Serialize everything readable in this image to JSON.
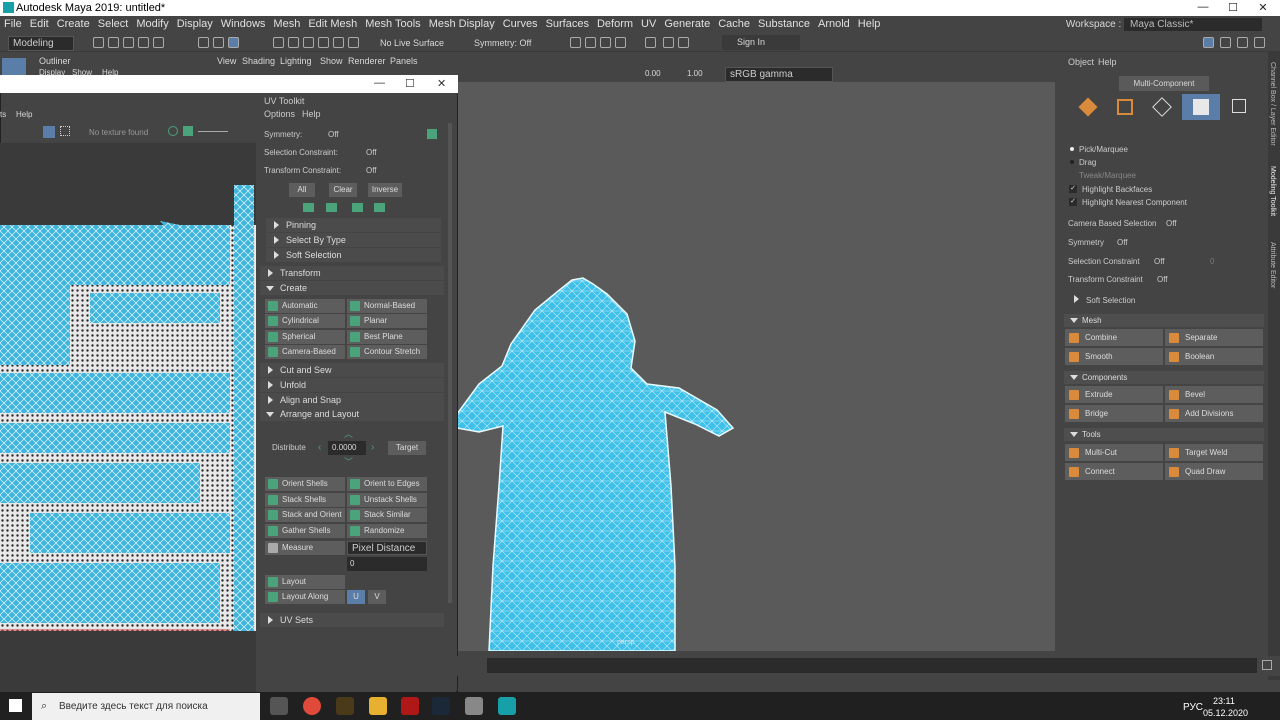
{
  "title": {
    "text": "Autodesk Maya 2019: untitled*",
    "min": "—",
    "max": "☐",
    "close": "✕"
  },
  "menu": [
    "File",
    "Edit",
    "Create",
    "Select",
    "Modify",
    "Display",
    "Windows",
    "Mesh",
    "Edit Mesh",
    "Mesh Tools",
    "Mesh Display",
    "Curves",
    "Surfaces",
    "Deform",
    "UV",
    "Generate",
    "Cache",
    "Substance",
    "Arnold",
    "Help"
  ],
  "workspace": {
    "label": "Workspace :",
    "value": "Maya Classic*"
  },
  "status": {
    "mode": "Modeling",
    "live": "No Live Surface",
    "symmetry": "Symmetry: Off",
    "signin": "Sign In"
  },
  "outliner": {
    "title": "Outliner",
    "menu": [
      "Display",
      "Show",
      "Help"
    ]
  },
  "viewport": {
    "menu": [
      "View",
      "Shading",
      "Lighting",
      "Show",
      "Renderer",
      "Panels"
    ],
    "v1": "0.00",
    "v2": "1.00",
    "gamma": "sRGB gamma",
    "label": "persp"
  },
  "uveditor": {
    "menu": [
      "ts",
      "Help"
    ],
    "notex": "No texture found",
    "min": "—",
    "max": "☐",
    "close": "✕"
  },
  "toolkit": {
    "title": "UV Toolkit",
    "menu": [
      "Options",
      "Help"
    ],
    "symmetry": "Symmetry:",
    "symval": "Off",
    "selc": "Selection Constraint:",
    "selval": "Off",
    "trc": "Transform Constraint:",
    "trval": "Off",
    "all": "All",
    "clear": "Clear",
    "inverse": "Inverse",
    "pinning": "Pinning",
    "bytype": "Select By Type",
    "soft": "Soft Selection",
    "transform": "Transform",
    "create": "Create",
    "createbtns": [
      "Automatic",
      "Normal-Based",
      "Cylindrical",
      "Planar",
      "Spherical",
      "Best Plane",
      "Camera-Based",
      "Contour Stretch"
    ],
    "cutsew": "Cut and Sew",
    "unfold": "Unfold",
    "align": "Align and Snap",
    "arrange": "Arrange and Layout",
    "distribute": "Distribute",
    "distval": "0.0000",
    "target": "Target",
    "layoutbtns": [
      "Orient Shells",
      "Orient to Edges",
      "Stack Shells",
      "Unstack Shells",
      "Stack and Orient",
      "Stack Similar",
      "Gather Shells",
      "Randomize Shells"
    ],
    "measure": "Measure",
    "measval": "Pixel Distance",
    "measnum": "0",
    "layout": "Layout",
    "layoutalong": "Layout Along",
    "u": "U",
    "v": "V",
    "uvsets": "UV Sets"
  },
  "right": {
    "menu": [
      "Object",
      "Help"
    ],
    "mc": "Multi-Component",
    "pick": "Pick/Marquee",
    "drag": "Drag",
    "tweak": "Tweak/Marquee",
    "hb": "Highlight Backfaces",
    "hn": "Highlight Nearest Component",
    "cbs": "Camera Based Selection",
    "cbsv": "Off",
    "sym": "Symmetry",
    "symv": "Off",
    "sc": "Selection Constraint",
    "scv": "Off",
    "scn": "0",
    "tc": "Transform Constraint",
    "tcv": "Off",
    "soft": "Soft Selection",
    "mesh": "Mesh",
    "meshbtns": [
      "Combine",
      "Separate",
      "Smooth",
      "Boolean"
    ],
    "comp": "Components",
    "compbtns": [
      "Extrude",
      "Bevel",
      "Bridge",
      "Add Divisions"
    ],
    "tools": "Tools",
    "toolbtns": [
      "Multi-Cut",
      "Target Weld",
      "Connect",
      "Quad Draw"
    ],
    "vtabs": [
      "Channel Box / Layer Editor",
      "Modeling Toolkit",
      "Attribute Editor"
    ]
  },
  "taskbar": {
    "search": "Введите здесь текст для поиска",
    "lang": "РУС",
    "time": "23:11",
    "date": "05.12.2020"
  }
}
